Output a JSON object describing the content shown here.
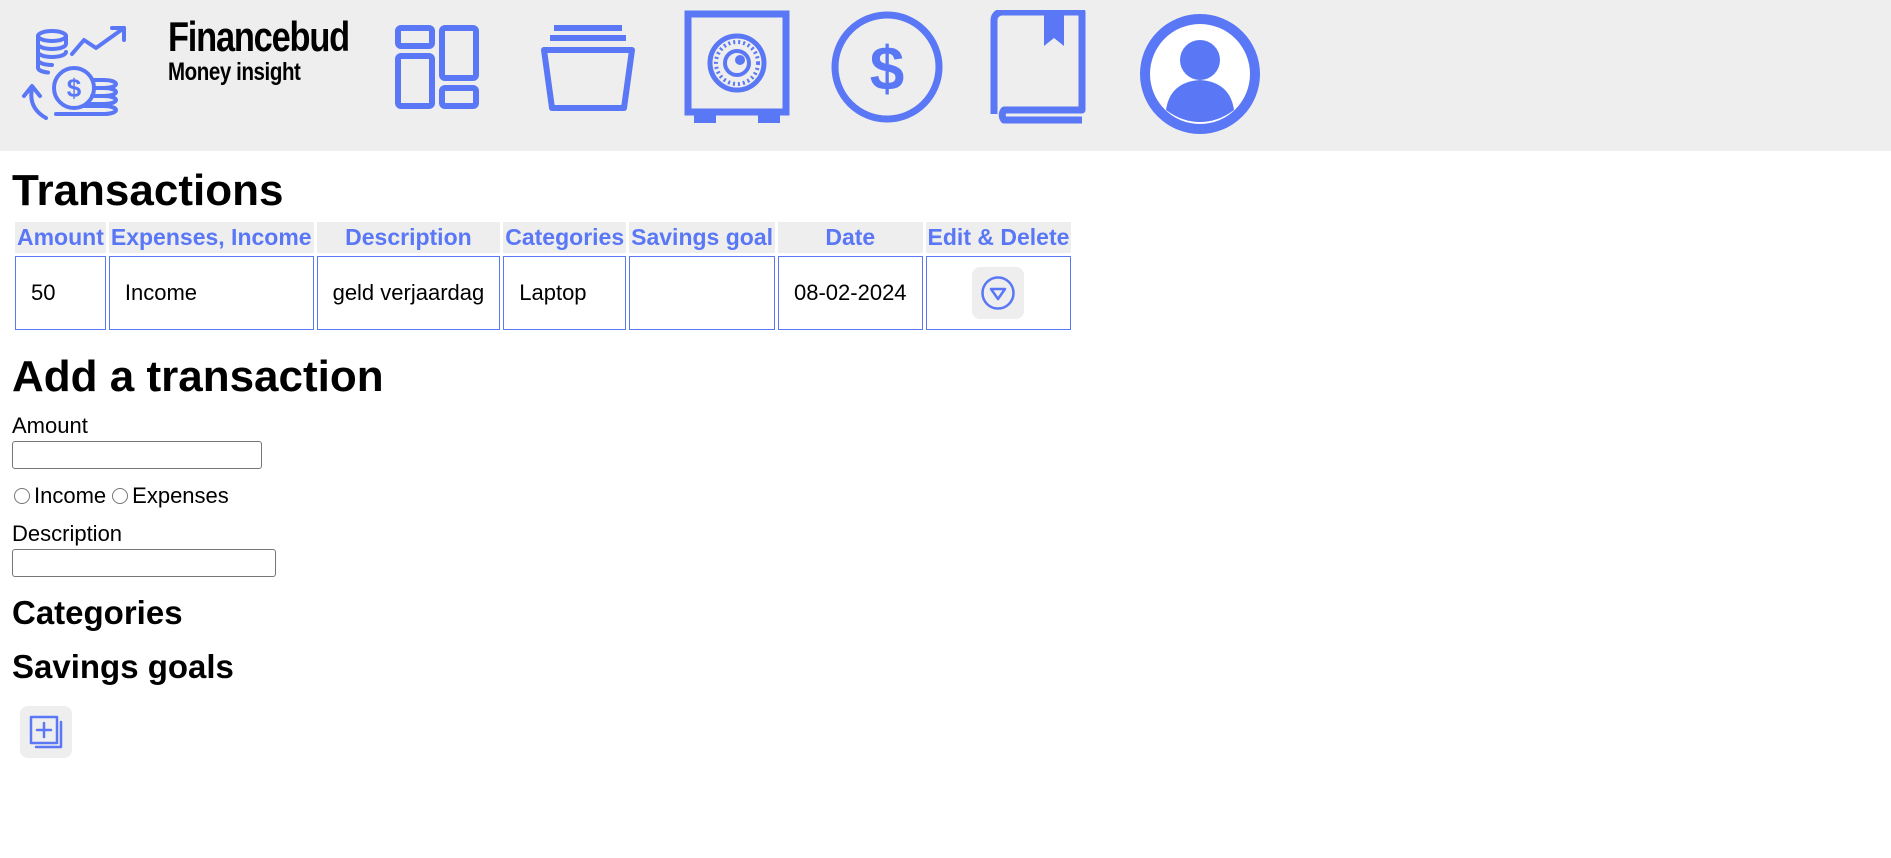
{
  "brand": {
    "name": "Financebud",
    "tagline": "Money insight"
  },
  "colors": {
    "accent": "#5a77f5",
    "topbar_bg": "#eeeeee"
  },
  "nav": {
    "items": [
      {
        "name": "logo-icon"
      },
      {
        "name": "dashboard-icon"
      },
      {
        "name": "folder-icon"
      },
      {
        "name": "safe-icon"
      },
      {
        "name": "dollar-icon"
      },
      {
        "name": "bookmark-book-icon"
      },
      {
        "name": "user-profile-icon"
      }
    ]
  },
  "transactions": {
    "title": "Transactions",
    "columns": [
      "Amount",
      "Expenses, Income",
      "Description",
      "Categories",
      "Savings goal",
      "Date",
      "Edit & Delete"
    ],
    "rows": [
      {
        "amount": "50",
        "type": "Income",
        "description": "geld verjaardag",
        "category": "Laptop",
        "savings_goal": "",
        "date": "08-02-2024"
      }
    ]
  },
  "form": {
    "title": "Add a transaction",
    "amount_label": "Amount",
    "amount_value": "",
    "income_label": "Income",
    "expenses_label": "Expenses",
    "description_label": "Description",
    "description_value": "",
    "categories_title": "Categories",
    "savings_title": "Savings goals"
  }
}
